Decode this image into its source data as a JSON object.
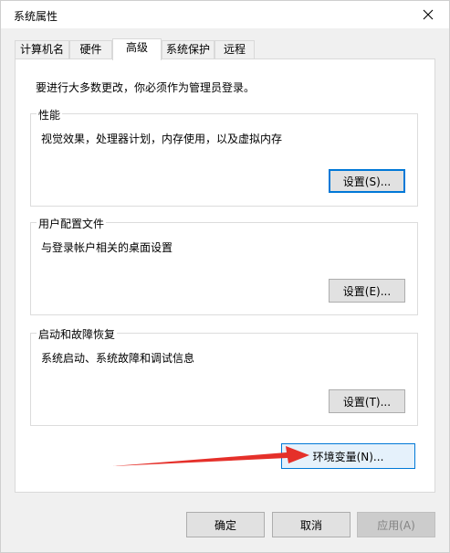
{
  "window": {
    "title": "系统属性"
  },
  "tabs": [
    {
      "label": "计算机名"
    },
    {
      "label": "硬件"
    },
    {
      "label": "高级"
    },
    {
      "label": "系统保护"
    },
    {
      "label": "远程"
    }
  ],
  "advanced": {
    "notice": "要进行大多数更改，你必须作为管理员登录。",
    "performance": {
      "title": "性能",
      "description": "视觉效果，处理器计划，内存使用，以及虚拟内存",
      "button": "设置(S)..."
    },
    "user_profiles": {
      "title": "用户配置文件",
      "description": "与登录帐户相关的桌面设置",
      "button": "设置(E)..."
    },
    "startup_recovery": {
      "title": "启动和故障恢复",
      "description": "系统启动、系统故障和调试信息",
      "button": "设置(T)..."
    },
    "env_button": "环境变量(N)..."
  },
  "footer": {
    "ok": "确定",
    "cancel": "取消",
    "apply": "应用(A)"
  },
  "colors": {
    "accent": "#0078d7",
    "arrow": "#e5302a",
    "window_bg": "#f0f0f0"
  }
}
